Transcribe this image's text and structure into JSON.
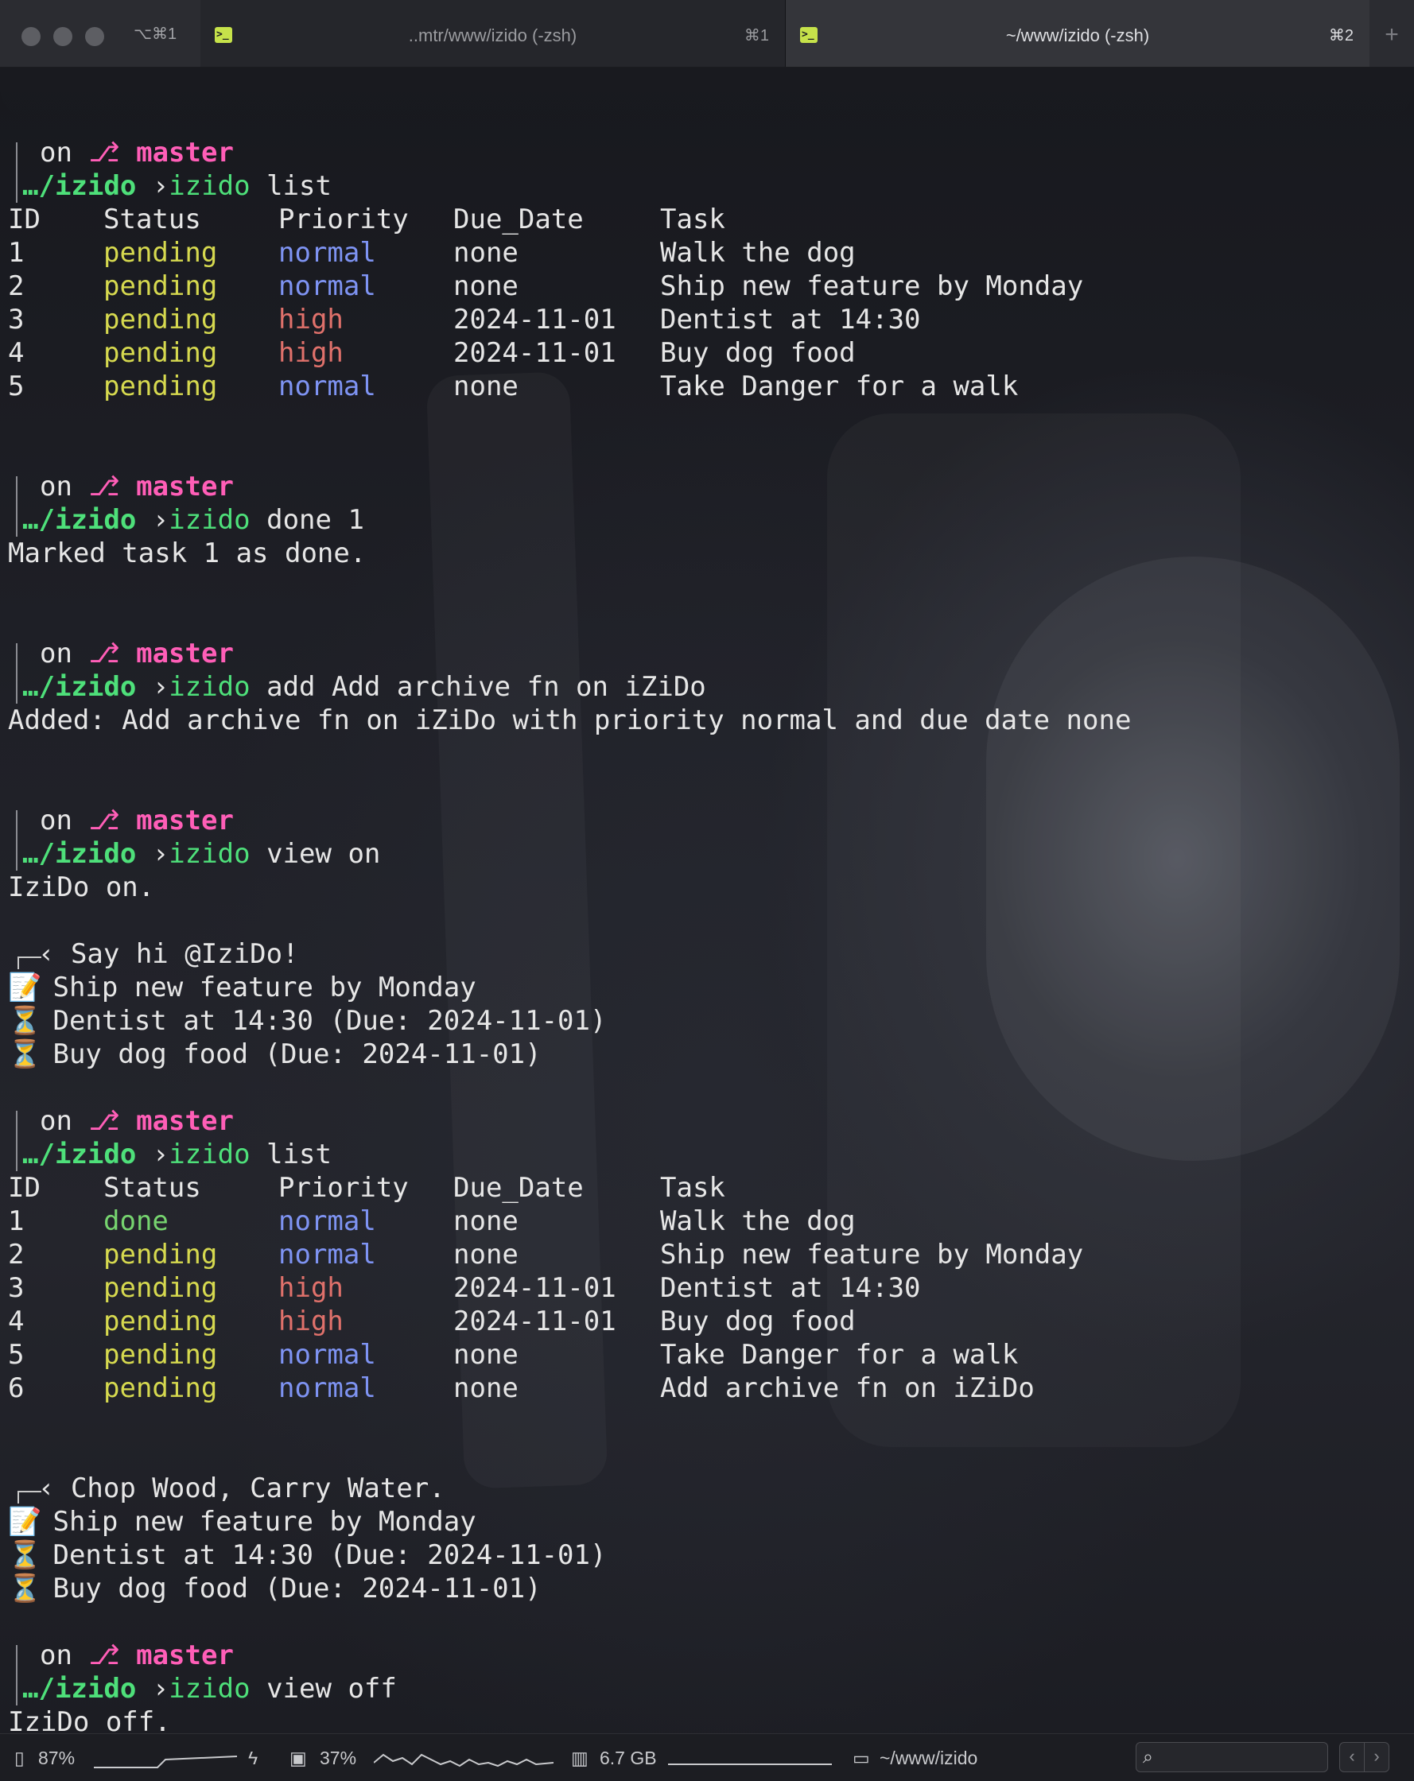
{
  "window": {
    "shortcut_all": "⌥⌘1",
    "tabs": [
      {
        "title": "..mtr/www/izido (-zsh)",
        "shortcut": "⌘1",
        "icon": "terminal-icon"
      },
      {
        "title": "~/www/izido (-zsh)",
        "shortcut": "⌘2",
        "icon": "terminal-icon"
      }
    ],
    "new_tab": "+"
  },
  "prompt": {
    "on": "on",
    "branch_icon": "⎇",
    "branch": "master",
    "path": "…/izido",
    "chevron": "›"
  },
  "blocks": [
    {
      "cmd": "izido",
      "args": " list"
    },
    {
      "cmd": "izido",
      "args": " done 1",
      "output": "Marked task 1 as done."
    },
    {
      "cmd": "izido",
      "args": " add Add archive fn on iZiDo",
      "output": "Added: Add archive fn on iZiDo with priority normal and due date none"
    },
    {
      "cmd": "izido",
      "args": " view on",
      "output": "IziDo on."
    },
    {
      "cmd": "izido",
      "args": " list"
    },
    {
      "cmd": "izido",
      "args": " view off",
      "output": "IziDo off."
    }
  ],
  "table_headers": [
    "ID",
    "Status",
    "Priority",
    "Due_Date",
    "Task"
  ],
  "table1": [
    {
      "id": "1",
      "status": "pending",
      "priority": "normal",
      "due": "none",
      "task": "Walk the dog"
    },
    {
      "id": "2",
      "status": "pending",
      "priority": "normal",
      "due": "none",
      "task": "Ship new feature by Monday"
    },
    {
      "id": "3",
      "status": "pending",
      "priority": "high",
      "due": "2024-11-01",
      "task": "Dentist at 14:30"
    },
    {
      "id": "4",
      "status": "pending",
      "priority": "high",
      "due": "2024-11-01",
      "task": "Buy dog food"
    },
    {
      "id": "5",
      "status": "pending",
      "priority": "normal",
      "due": "none",
      "task": "Take Danger for a walk"
    }
  ],
  "table2": [
    {
      "id": "1",
      "status": "done",
      "priority": "normal",
      "due": "none",
      "task": "Walk the dog"
    },
    {
      "id": "2",
      "status": "pending",
      "priority": "normal",
      "due": "none",
      "task": "Ship new feature by Monday"
    },
    {
      "id": "3",
      "status": "pending",
      "priority": "high",
      "due": "2024-11-01",
      "task": "Dentist at 14:30"
    },
    {
      "id": "4",
      "status": "pending",
      "priority": "high",
      "due": "2024-11-01",
      "task": "Buy dog food"
    },
    {
      "id": "5",
      "status": "pending",
      "priority": "normal",
      "due": "none",
      "task": "Take Danger for a walk"
    },
    {
      "id": "6",
      "status": "pending",
      "priority": "normal",
      "due": "none",
      "task": "Add archive fn on iZiDo"
    }
  ],
  "view1": {
    "header": "‹ Say hi @IziDo!",
    "items": [
      {
        "icon": "📝",
        "text": "Ship new feature by Monday"
      },
      {
        "icon": "⏳",
        "text": "Dentist at 14:30 (Due: 2024-11-01)"
      },
      {
        "icon": "⏳",
        "text": "Buy dog food (Due: 2024-11-01)"
      }
    ]
  },
  "view2": {
    "header": "‹ Chop Wood, Carry Water.",
    "items": [
      {
        "icon": "📝",
        "text": "Ship new feature by Monday"
      },
      {
        "icon": "⏳",
        "text": "Dentist at 14:30 (Due: 2024-11-01)"
      },
      {
        "icon": "⏳",
        "text": "Buy dog food (Due: 2024-11-01)"
      }
    ]
  },
  "statusbar": {
    "battery": "87%",
    "cpu": "37%",
    "memory": "6.7 GB",
    "cwd": "~/www/izido",
    "colors": {
      "status_pending": "#d6d94f",
      "status_done": "#76d46f",
      "priority_normal": "#7e93f2",
      "priority_high": "#e0716b",
      "path": "#4ee07a",
      "branch": "#ff5eb7"
    }
  }
}
